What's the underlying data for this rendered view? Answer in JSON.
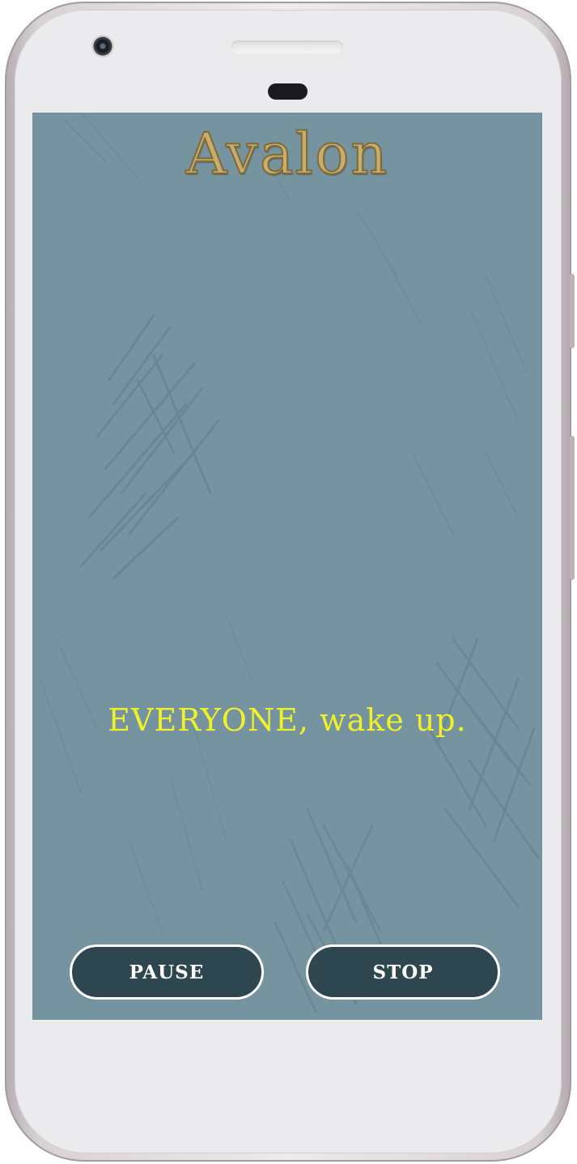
{
  "app": {
    "title": "Avalon"
  },
  "main": {
    "message": "EVERYONE, wake up."
  },
  "controls": {
    "pause_label": "PAUSE",
    "stop_label": "STOP"
  },
  "colors": {
    "background": "#7594a0",
    "title": "#c9ad6b",
    "message": "#f1f12a",
    "button_fill": "#2e4650",
    "button_border": "#ffffff"
  }
}
